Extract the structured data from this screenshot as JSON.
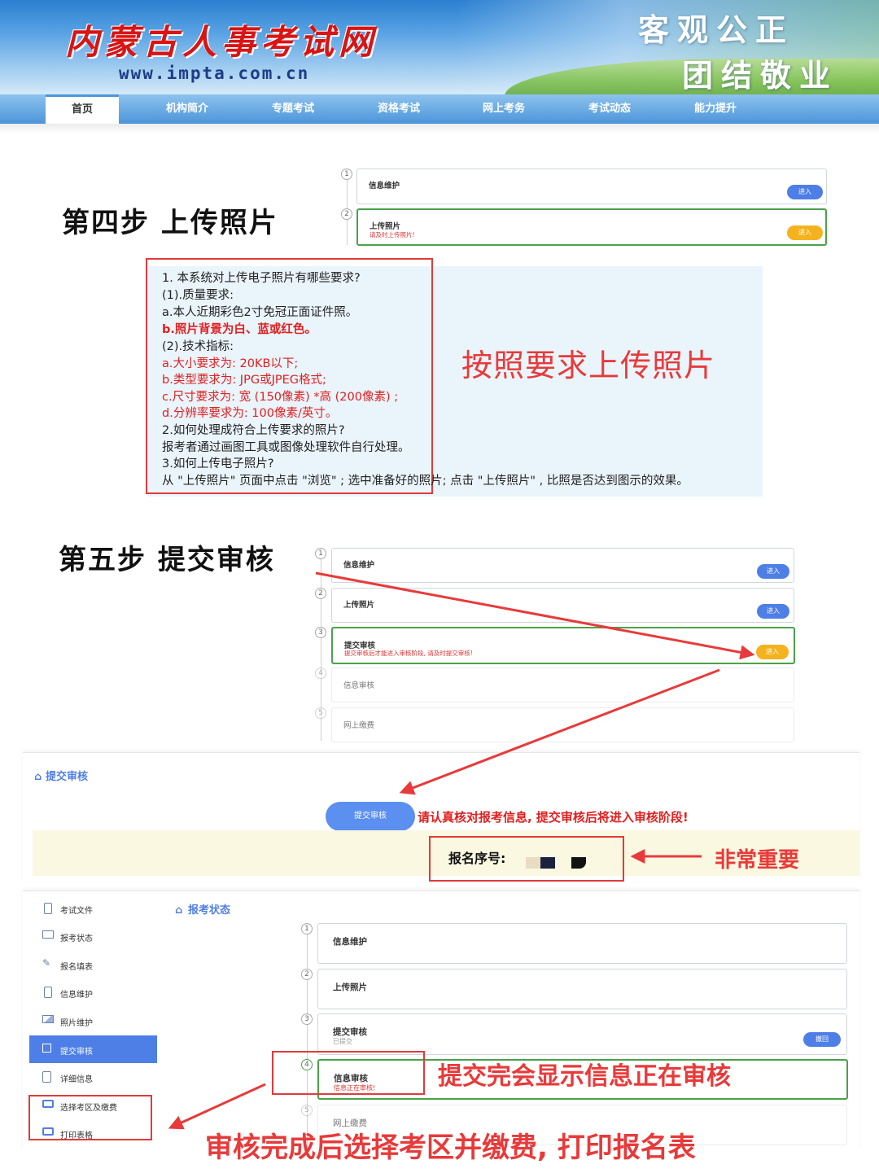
{
  "header": {
    "site_title": "内蒙古人事考试网",
    "site_url": "www.impta.com.cn",
    "motto_line1": "客观公正",
    "motto_line2": "团结敬业"
  },
  "nav": {
    "items": [
      "首页",
      "机构简介",
      "专题考试",
      "资格考试",
      "网上考务",
      "考试动态",
      "能力提升"
    ],
    "active": "首页"
  },
  "step4": {
    "title": "第四步  上传照片",
    "cards": [
      {
        "num": "1",
        "title": "信息维护",
        "sub": "",
        "button": "进入"
      },
      {
        "num": "2",
        "title": "上传照片",
        "sub": "请及时上传照片!",
        "button": "进入"
      }
    ],
    "faq": [
      "1. 本系统对上传电子照片有哪些要求?",
      "(1).质量要求:",
      "a.本人近期彩色2寸免冠正面证件照。",
      "b.照片背景为白、蓝或红色。",
      "(2).技术指标:",
      "a.大小要求为:  20KB以下;",
      "b.类型要求为:  JPG或JPEG格式;",
      "c.尺寸要求为:  宽 (150像素) *高 (200像素) ;",
      "d.分辨率要求为:  100像素/英寸。",
      "2.如何处理成符合上传要求的照片?",
      "报考者通过画图工具或图像处理软件自行处理。",
      "3.如何上传电子照片?",
      "从 \"上传照片\" 页面中点击 \"浏览\" ;  选中准备好的照片;  点击 \"上传照片\" ,  比照是否达到图示的效果。"
    ],
    "annotation": "按照要求上传照片"
  },
  "step5": {
    "title": "第五步  提交审核",
    "cards": [
      {
        "num": "1",
        "title": "信息维护",
        "sub": "",
        "button": "进入"
      },
      {
        "num": "2",
        "title": "上传照片",
        "sub": "",
        "button": "进入"
      },
      {
        "num": "3",
        "title": "提交审核",
        "sub": "提交审核后才能进入审核阶段,  请及时提交审核!",
        "button": "进入"
      },
      {
        "num": "4",
        "title": "信息审核",
        "sub": "",
        "button": ""
      },
      {
        "num": "5",
        "title": "网上缴费",
        "sub": "",
        "button": ""
      }
    ]
  },
  "submit_panel": {
    "heading": "提交审核",
    "button": "提交审核",
    "warning": "请认真核对报考信息,  提交审核后将进入审核阶段!",
    "reg_label": "报名序号:",
    "annotation": "非常重要"
  },
  "status_panel": {
    "heading": "报考状态",
    "sidebar": [
      "考试文件",
      "报考状态",
      "报名填表",
      "信息维护",
      "照片维护",
      "提交审核",
      "详细信息",
      "选择考区及缴费",
      "打印表格"
    ],
    "sidebar_active": "提交审核",
    "cards": [
      {
        "num": "1",
        "title": "信息维护",
        "sub": "",
        "button": ""
      },
      {
        "num": "2",
        "title": "上传照片",
        "sub": "",
        "button": ""
      },
      {
        "num": "3",
        "title": "提交审核",
        "sub": "已提交",
        "button": "撤回"
      },
      {
        "num": "4",
        "title": "信息审核",
        "sub": "信息正在审核!",
        "button": ""
      },
      {
        "num": "5",
        "title": "网上缴费",
        "sub": "",
        "button": ""
      }
    ],
    "annotation_review": "提交完会显示信息正在审核",
    "annotation_bottom": "审核完成后选择考区并缴费,  打印报名表"
  },
  "colors": {
    "accent_blue": "#4e7fe6",
    "annotation_red": "#e83a3a",
    "button_orange": "#f5b21f",
    "active_green": "#4aa24a"
  }
}
